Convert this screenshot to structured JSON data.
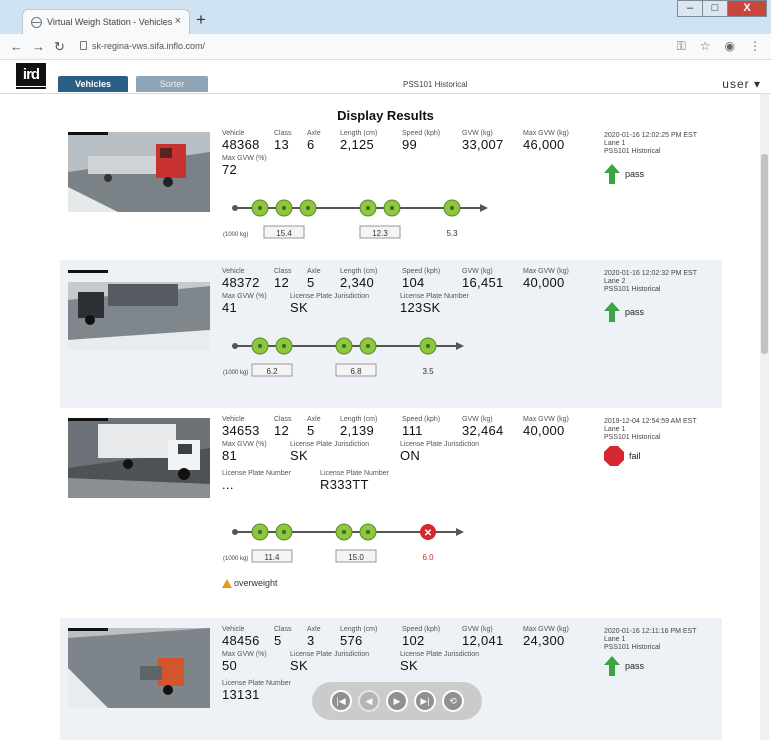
{
  "browser": {
    "tab_title": "Virtual Weigh Station - Vehicles",
    "tab_close": "×",
    "new_tab": "+",
    "url": "sk-regina-vws.sifa.inflo.com/",
    "window_buttons": {
      "minimize": "–",
      "maximize": "□",
      "close": "X"
    }
  },
  "app": {
    "logo": "ird",
    "tabs": [
      {
        "label": "Vehicles"
      },
      {
        "label": "Sorter"
      }
    ],
    "site_label": "PSS101 Historical",
    "user_menu": "user ▾",
    "page_title": "Display Results"
  },
  "labels": {
    "vehicle": "Vehicle",
    "class": "Class",
    "axle": "Axle",
    "length": "Length (cm)",
    "speed": "Speed (kph)",
    "gvw": "GVW (kg)",
    "max_gvw": "Max GVW (kg)",
    "max_gvw_pct": "Max GVW (%)",
    "plate_jurisdiction": "License Plate Jurisdiction",
    "plate_number": "License Plate Number",
    "axle_units": "(1000 kg)"
  },
  "records": [
    {
      "vehicle": "48368",
      "class": "13",
      "axle": "6",
      "length": "2,125",
      "speed": "99",
      "gvw": "33,007",
      "max_gvw": "46,000",
      "max_gvw_pct": "72",
      "timestamp": "2020-01-16 12:02:25 PM EST",
      "lane": "Lane 1",
      "site": "PSS101 Historical",
      "status": "pass",
      "axle_groups": [
        {
          "value": "15.4",
          "positions": [
            0,
            1,
            2
          ]
        },
        {
          "value": "12.3",
          "positions": [
            3,
            4
          ]
        },
        {
          "value": "5.3",
          "positions": [
            5
          ]
        }
      ]
    },
    {
      "vehicle": "48372",
      "class": "12",
      "axle": "5",
      "length": "2,340",
      "speed": "104",
      "gvw": "16,451",
      "max_gvw": "40,000",
      "max_gvw_pct": "41",
      "plate_jurisdiction": "SK",
      "plate_number": "123SK",
      "timestamp": "2020-01-16 12:02:32 PM EST",
      "lane": "Lane 2",
      "site": "PSS101 Historical",
      "status": "pass",
      "axle_groups": [
        {
          "value": "6.2",
          "positions": [
            0,
            1
          ]
        },
        {
          "value": "6.8",
          "positions": [
            2,
            3
          ]
        },
        {
          "value": "3.5",
          "positions": [
            4
          ]
        }
      ]
    },
    {
      "vehicle": "34653",
      "class": "12",
      "axle": "5",
      "length": "2,139",
      "speed": "111",
      "gvw": "32,464",
      "max_gvw": "40,000",
      "max_gvw_pct": "81",
      "plate_jurisdiction": "SK",
      "plate_jurisdiction_2": "ON",
      "plate_number": "...",
      "plate_number_2": "R333TT",
      "timestamp": "2019-12-04 12:54:59 AM EST",
      "lane": "Lane 1",
      "site": "PSS101 Historical",
      "status": "fail",
      "warning": "overweight",
      "axle_groups": [
        {
          "value": "11.4",
          "positions": [
            0,
            1
          ]
        },
        {
          "value": "15.0",
          "positions": [
            2,
            3
          ]
        },
        {
          "value": "6.0",
          "positions": [
            4
          ],
          "fail": true
        }
      ]
    },
    {
      "vehicle": "48456",
      "class": "5",
      "axle": "3",
      "length": "576",
      "speed": "102",
      "gvw": "12,041",
      "max_gvw": "24,300",
      "max_gvw_pct": "50",
      "plate_jurisdiction": "SK",
      "plate_jurisdiction_2": "SK",
      "plate_number": "13131",
      "timestamp": "2020-01-16 12:11:16 PM EST",
      "lane": "Lane 1",
      "site": "PSS101 Historical",
      "status": "pass"
    }
  ],
  "media_controls": [
    {
      "name": "first-button",
      "glyph": "|◀"
    },
    {
      "name": "previous-button",
      "glyph": "◀"
    },
    {
      "name": "play-button",
      "glyph": "▶"
    },
    {
      "name": "last-button",
      "glyph": "▶|"
    },
    {
      "name": "loop-button",
      "glyph": "⟲"
    }
  ],
  "colors": {
    "accent": "#2b5f86",
    "pass": "#3aa541",
    "fail": "#d7262d",
    "axle": "#8dc63f"
  }
}
